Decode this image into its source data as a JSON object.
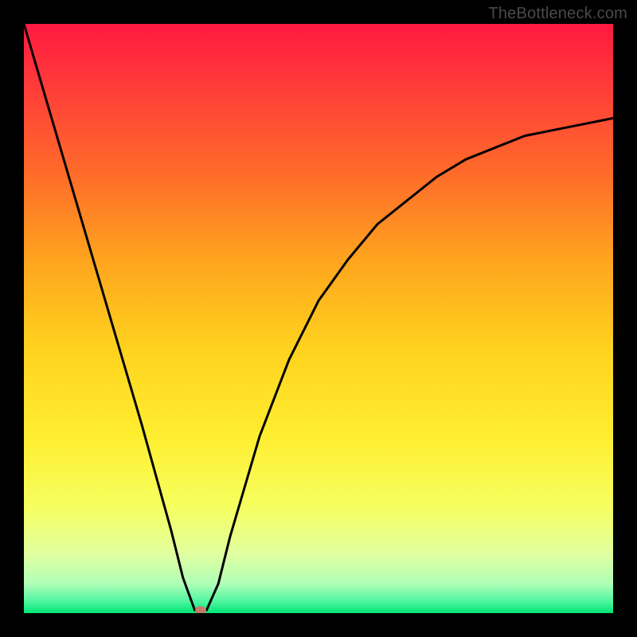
{
  "watermark": "TheBottleneck.com",
  "chart_data": {
    "type": "line",
    "title": "",
    "xlabel": "",
    "ylabel": "",
    "xlim": [
      0,
      1
    ],
    "ylim": [
      0,
      1
    ],
    "x": [
      0.0,
      0.05,
      0.1,
      0.15,
      0.2,
      0.25,
      0.27,
      0.29,
      0.31,
      0.33,
      0.35,
      0.4,
      0.45,
      0.5,
      0.55,
      0.6,
      0.65,
      0.7,
      0.75,
      0.8,
      0.85,
      0.9,
      0.95,
      1.0
    ],
    "values": [
      1.0,
      0.83,
      0.66,
      0.49,
      0.32,
      0.14,
      0.06,
      0.005,
      0.005,
      0.05,
      0.13,
      0.3,
      0.43,
      0.53,
      0.6,
      0.66,
      0.7,
      0.74,
      0.77,
      0.79,
      0.81,
      0.82,
      0.83,
      0.84
    ],
    "marker": {
      "x": 0.3,
      "y": 0.005
    },
    "gradient_stops": [
      {
        "offset": 0.0,
        "color": "#ff1a40"
      },
      {
        "offset": 0.1,
        "color": "#ff3a3a"
      },
      {
        "offset": 0.25,
        "color": "#ff6a2a"
      },
      {
        "offset": 0.4,
        "color": "#ffa41e"
      },
      {
        "offset": 0.55,
        "color": "#ffd21e"
      },
      {
        "offset": 0.7,
        "color": "#ffee30"
      },
      {
        "offset": 0.82,
        "color": "#f6ff60"
      },
      {
        "offset": 0.9,
        "color": "#e0ffa0"
      },
      {
        "offset": 0.95,
        "color": "#b0ffb8"
      },
      {
        "offset": 0.98,
        "color": "#50f5a0"
      },
      {
        "offset": 1.0,
        "color": "#00e676"
      }
    ]
  }
}
